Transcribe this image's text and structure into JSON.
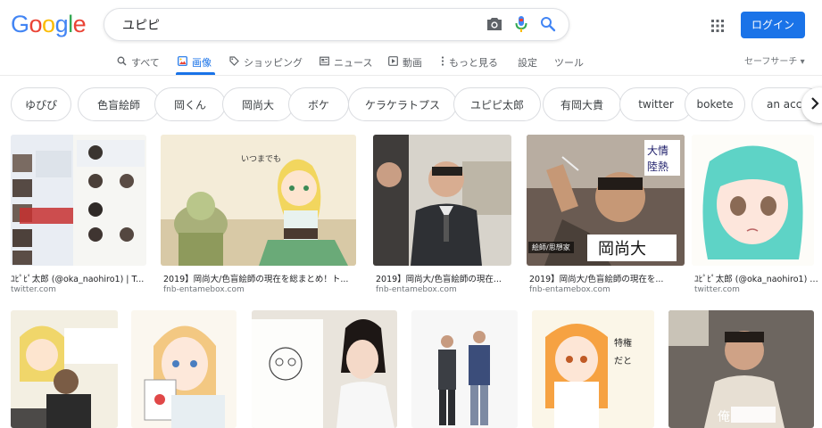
{
  "search": {
    "query": "ユピピ"
  },
  "header": {
    "login_label": "ログイン"
  },
  "colors": {
    "blue": "#4285F4",
    "red": "#EA4335",
    "yellow": "#FBBC05",
    "green": "#34A853",
    "accent": "#1a73e8"
  },
  "logo": {
    "letters": [
      "G",
      "o",
      "o",
      "g",
      "l",
      "e"
    ]
  },
  "tabs": [
    {
      "label": "すべて",
      "icon": "search-icon"
    },
    {
      "label": "画像",
      "icon": "image-icon",
      "active": true
    },
    {
      "label": "ショッピング",
      "icon": "tag-icon"
    },
    {
      "label": "ニュース",
      "icon": "news-icon"
    },
    {
      "label": "動画",
      "icon": "play-icon"
    },
    {
      "label": "もっと見る",
      "icon": "more-vert-icon"
    },
    {
      "label": "設定"
    },
    {
      "label": "ツール"
    }
  ],
  "safesearch": {
    "label": "セーフサーチ"
  },
  "chips": [
    "ゆぴぴ",
    "色盲絵師",
    "岡くん",
    "岡尚大",
    "ボケ",
    "ケラケラトプス",
    "ユピピ太郎",
    "有岡大貴",
    "twitter",
    "bokete",
    "an acco"
  ],
  "results_row1": [
    {
      "caption": "ﾕﾋﾟﾋﾟ太郎 (@oka_naohiro1) | T...",
      "source": "twitter.com"
    },
    {
      "caption": "2019】岡尚大/色盲絵師の現在を総まとめ！ト...",
      "source": "fnb-entamebox.com"
    },
    {
      "caption": "2019】岡尚大/色盲絵師の現在...",
      "source": "fnb-entamebox.com"
    },
    {
      "caption": "2019】岡尚大/色盲絵師の現在を...",
      "source": "fnb-entamebox.com",
      "overlay": "絵師/思想家"
    },
    {
      "caption": "ﾕﾋﾟﾋﾟ太郎 (@oka_naohiro1) | T...",
      "source": "twitter.com"
    }
  ]
}
